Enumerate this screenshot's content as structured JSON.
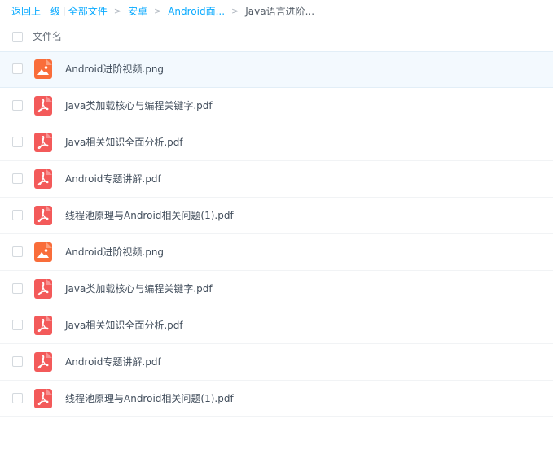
{
  "breadcrumb": {
    "back": "返回上一级",
    "pipe": "|",
    "all_files": "全部文件",
    "sep": ">",
    "level1": "安卓",
    "level2": "Android面...",
    "current": "Java语言进阶..."
  },
  "header": {
    "name_column": "文件名"
  },
  "colors": {
    "link": "#09aaff",
    "image_icon": "#f96d3a",
    "pdf_icon": "#f35a5a",
    "hover_row": "#f3f9fe"
  },
  "files": [
    {
      "name": "Android进阶视频.png",
      "icon": "image-icon",
      "hovered": true
    },
    {
      "name": "Java类加载核心与编程关键字.pdf",
      "icon": "pdf-icon",
      "hovered": false
    },
    {
      "name": "Java相关知识全面分析.pdf",
      "icon": "pdf-icon",
      "hovered": false
    },
    {
      "name": "Android专题讲解.pdf",
      "icon": "pdf-icon",
      "hovered": false
    },
    {
      "name": "线程池原理与Android相关问题(1).pdf",
      "icon": "pdf-icon",
      "hovered": false
    },
    {
      "name": "Android进阶视频.png",
      "icon": "image-icon",
      "hovered": false
    },
    {
      "name": "Java类加载核心与编程关键字.pdf",
      "icon": "pdf-icon",
      "hovered": false
    },
    {
      "name": "Java相关知识全面分析.pdf",
      "icon": "pdf-icon",
      "hovered": false
    },
    {
      "name": "Android专题讲解.pdf",
      "icon": "pdf-icon",
      "hovered": false
    },
    {
      "name": "线程池原理与Android相关问题(1).pdf",
      "icon": "pdf-icon",
      "hovered": false
    }
  ]
}
